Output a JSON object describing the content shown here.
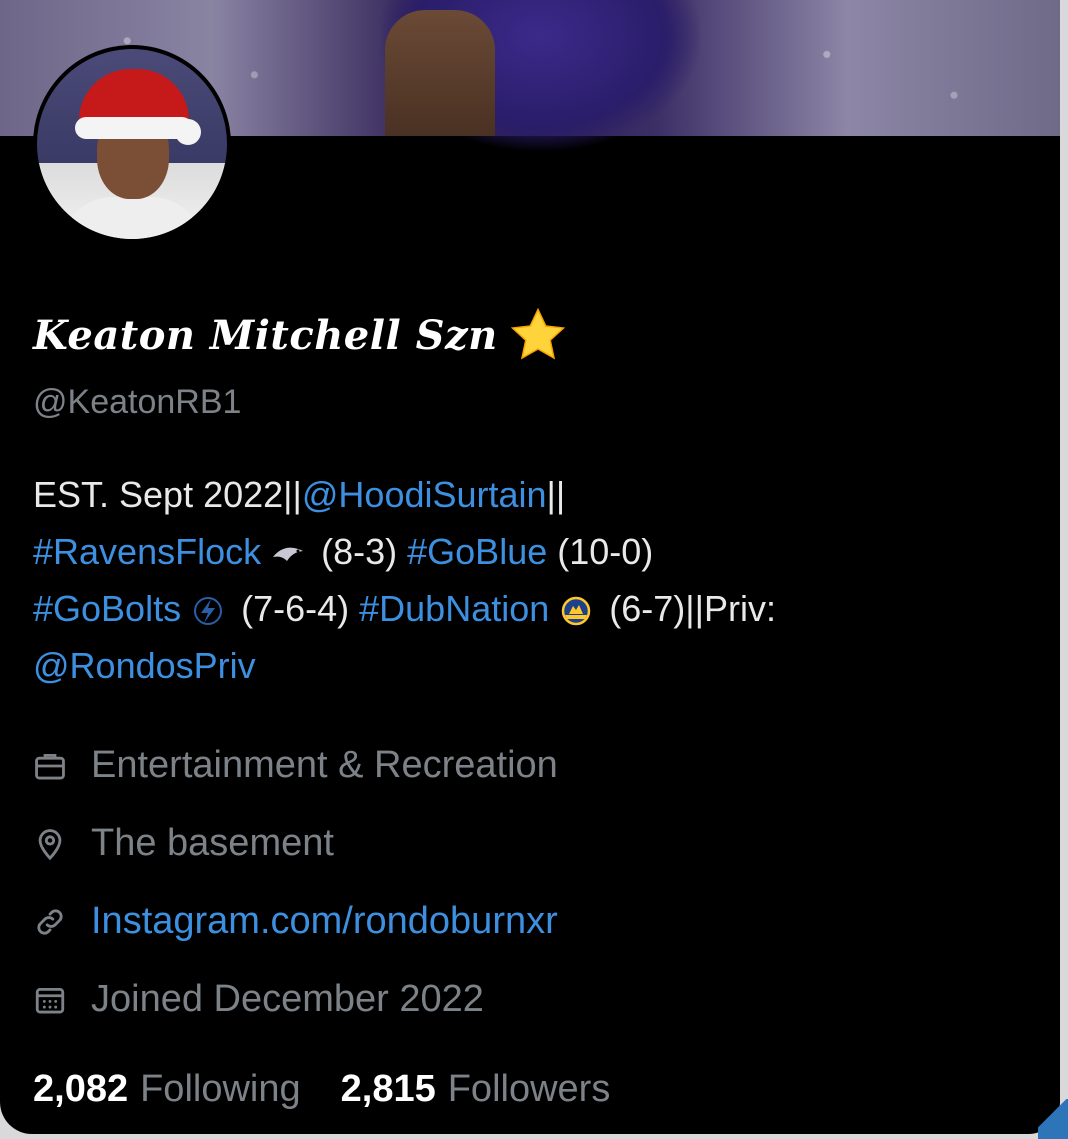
{
  "profile": {
    "display_name": "Keaton Mitchell Szn",
    "display_name_emoji": "star-icon",
    "handle": "@KeatonRB1",
    "bio": {
      "t1": "EST. Sept 2022||",
      "mention1": "@HoodiSurtain",
      "t2": "||",
      "tag1": "#RavensFlock",
      "rec1": "(8-3)",
      "tag2": "#GoBlue",
      "rec2": "(10-0)",
      "tag3": "#GoBolts",
      "rec3": "(7-6-4)",
      "tag4": "#DubNation",
      "rec4": "(6-7)||Priv:",
      "mention2": "@RondosPriv"
    },
    "category": "Entertainment & Recreation",
    "location": "The basement",
    "website": "Instagram.com/rondoburnxr",
    "joined": "Joined December 2022",
    "following_count": "2,082",
    "following_label": "Following",
    "followers_count": "2,815",
    "followers_label": "Followers"
  },
  "colors": {
    "background": "#000000",
    "link": "#3d8fe0",
    "muted": "#7c8287",
    "text": "#e9e9ea"
  }
}
